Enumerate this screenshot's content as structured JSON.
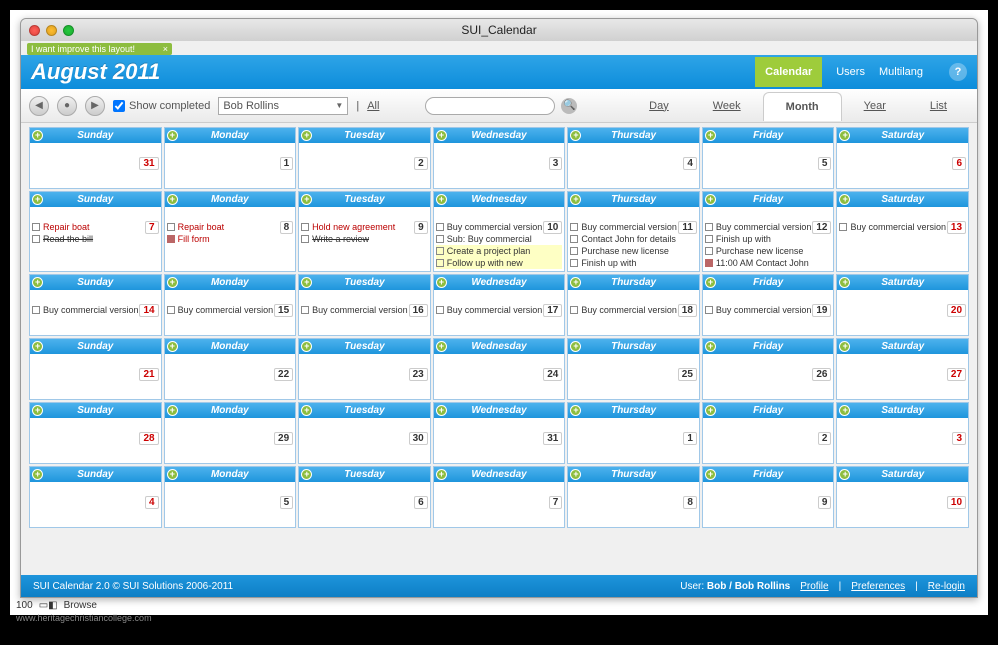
{
  "window": {
    "title": "SUI_Calendar"
  },
  "banner": {
    "text": "I want improve this layout!"
  },
  "header": {
    "title": "August 2011",
    "tabs": [
      "Calendar",
      "Users",
      "Multilang"
    ],
    "active_tab": "Calendar"
  },
  "toolbar": {
    "show_completed": "Show completed",
    "user_select": "Bob Rollins",
    "all": "All",
    "views": [
      "Day",
      "Week",
      "Month",
      "Year",
      "List"
    ],
    "active_view": "Month"
  },
  "days": [
    "Sunday",
    "Monday",
    "Tuesday",
    "Wednesday",
    "Thursday",
    "Friday",
    "Saturday"
  ],
  "weeks": [
    {
      "nums": [
        "31",
        "1",
        "2",
        "3",
        "4",
        "5",
        "6"
      ],
      "red": [
        0,
        6
      ],
      "events": [
        [],
        [],
        [],
        [],
        [],
        [],
        []
      ]
    },
    {
      "nums": [
        "7",
        "8",
        "9",
        "10",
        "11",
        "12",
        "13"
      ],
      "red": [
        0,
        6
      ],
      "tall": true,
      "events": [
        [
          {
            "t": "Repair boat",
            "c": "red"
          },
          {
            "t": "Read the bill",
            "c": "strike"
          }
        ],
        [
          {
            "t": "Repair boat",
            "c": "red"
          },
          {
            "t": "Fill form",
            "c": "red",
            "icon": "pp"
          }
        ],
        [
          {
            "t": "Hold new agreement",
            "c": "red"
          },
          {
            "t": "Write a review",
            "c": "strike"
          }
        ],
        [
          {
            "t": "Buy commercial version or"
          },
          {
            "t": "Sub: Buy commercial"
          },
          {
            "t": "Create a project plan",
            "c": "hl"
          },
          {
            "t": "Follow up with new",
            "c": "hl"
          }
        ],
        [
          {
            "t": "Buy commercial version"
          },
          {
            "t": "Contact John for details"
          },
          {
            "t": "Purchase new license"
          },
          {
            "t": "Finish up with"
          }
        ],
        [
          {
            "t": "Buy commercial version"
          },
          {
            "t": "Finish up with"
          },
          {
            "t": "Purchase new license"
          },
          {
            "t": "11:00 AM Contact John",
            "icon": "pp"
          }
        ],
        [
          {
            "t": "Buy commercial version"
          }
        ]
      ]
    },
    {
      "nums": [
        "14",
        "15",
        "16",
        "17",
        "18",
        "19",
        "20"
      ],
      "red": [
        0,
        6
      ],
      "events": [
        [
          {
            "t": "Buy commercial version"
          }
        ],
        [
          {
            "t": "Buy commercial version"
          }
        ],
        [
          {
            "t": "Buy commercial version"
          }
        ],
        [
          {
            "t": "Buy commercial version"
          }
        ],
        [
          {
            "t": "Buy commercial version"
          }
        ],
        [
          {
            "t": "Buy commercial version"
          }
        ],
        []
      ]
    },
    {
      "nums": [
        "21",
        "22",
        "23",
        "24",
        "25",
        "26",
        "27"
      ],
      "red": [
        0,
        6
      ],
      "events": [
        [],
        [],
        [],
        [],
        [],
        [],
        []
      ]
    },
    {
      "nums": [
        "28",
        "29",
        "30",
        "31",
        "1",
        "2",
        "3"
      ],
      "red": [
        0,
        6
      ],
      "events": [
        [],
        [],
        [],
        [],
        [],
        [],
        []
      ]
    },
    {
      "nums": [
        "4",
        "5",
        "6",
        "7",
        "8",
        "9",
        "10"
      ],
      "red": [
        0,
        6
      ],
      "events": [
        [],
        [],
        [],
        [],
        [],
        [],
        []
      ]
    }
  ],
  "footer": {
    "copyright": "SUI Calendar 2.0 © SUI Solutions 2006-2011",
    "user_label": "User:",
    "user": "Bob / Bob Rollins",
    "links": [
      "Profile",
      "Preferences",
      "Re-login"
    ]
  },
  "status": {
    "zoom": "100",
    "mode": "Browse"
  },
  "watermark": "www.heritagechristiancollege.com"
}
